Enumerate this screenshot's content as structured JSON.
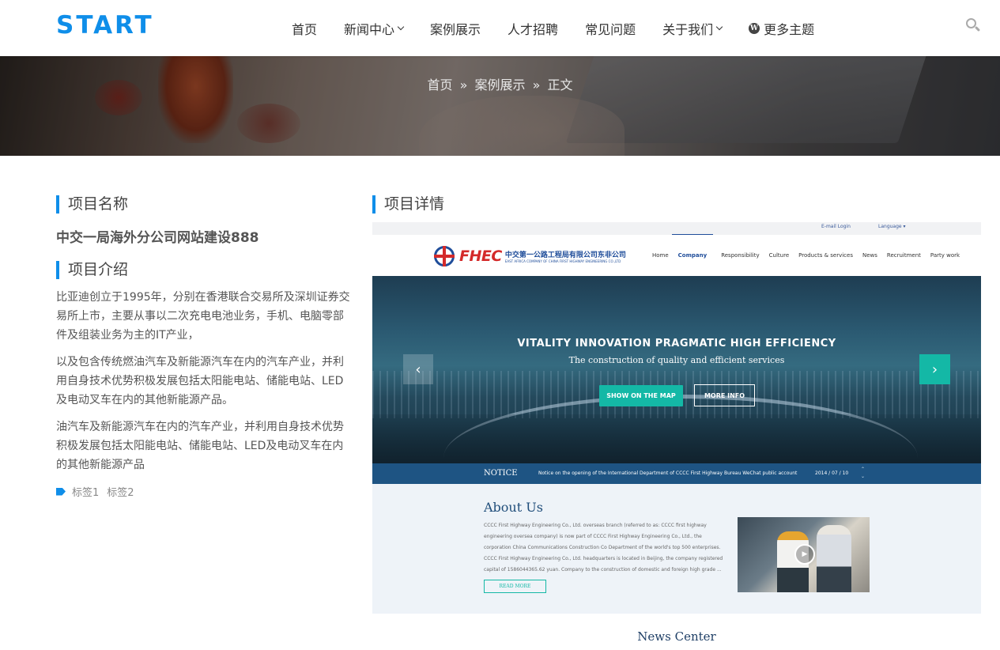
{
  "header": {
    "logo": "START",
    "nav": [
      {
        "label": "首页",
        "has_dropdown": false
      },
      {
        "label": "新闻中心",
        "has_dropdown": true
      },
      {
        "label": "案例展示",
        "has_dropdown": false
      },
      {
        "label": "人才招聘",
        "has_dropdown": false
      },
      {
        "label": "常见问题",
        "has_dropdown": false
      },
      {
        "label": "关于我们",
        "has_dropdown": true
      },
      {
        "label": "更多主题",
        "has_dropdown": false,
        "icon": "wordpress-icon"
      }
    ],
    "search_icon": "search-icon"
  },
  "banner": {
    "breadcrumb": [
      "首页",
      "案例展示",
      "正文"
    ],
    "separator": "»"
  },
  "left": {
    "name_title": "项目名称",
    "project_name": "中交一局海外分公司网站建设888",
    "intro_title": "项目介绍",
    "paragraphs": [
      "比亚迪创立于1995年，分别在香港联合交易所及深圳证券交易所上市，主要从事以二次充电电池业务，手机、电脑零部件及组装业务为主的IT产业，",
      "以及包含传统燃油汽车及新能源汽车在内的汽车产业，并利用自身技术优势积极发展包括太阳能电站、储能电站、LED及电动叉车在内的其他新能源产品。",
      "油汽车及新能源汽车在内的汽车产业，并利用自身技术优势积极发展包括太阳能电站、储能电站、LED及电动叉车在内的其他新能源产品"
    ],
    "tags": [
      "标签1",
      "标签2"
    ]
  },
  "right": {
    "detail_title": "项目详情",
    "mock": {
      "top_links": {
        "login": "E-mail Login",
        "language": "Language ▾"
      },
      "logo_text": "FHEC",
      "logo_cn": "中交第一公路工程局有限公司东非公司",
      "logo_en": "EAST AFRICA COMPANY OF CHINA FIRST HIGHWAY ENGINEERING CO.,LTD",
      "menu": [
        "Home",
        "Company",
        "Responsibility",
        "Culture",
        "Products & services",
        "News",
        "Recruitment",
        "Party work"
      ],
      "active_menu": "Company",
      "hero_title": "VITALITY  INNOVATION  PRAGMATIC  HIGH EFFICIENCY",
      "hero_subtitle": "The construction of quality and efficient services",
      "btn_map": "SHOW ON THE MAP",
      "btn_more": "MORE INFO",
      "notice_title": "NOTICE",
      "notice_text": "Notice on the opening of the International Department of CCCC First Highway Bureau WeChat public account",
      "notice_date": "2014 / 07 / 10",
      "about_title": "About Us",
      "about_text": "CCCC First Highway Engineering Co., Ltd. overseas branch (referred to as: CCCC first highway engineering oversea company) is now part of CCCC First Highway Engineering Co., Ltd., the corporation China Communications Construction Co Department of the world's top 500 enterprises. CCCC First Highway Engineering Co., Ltd. headquarters is located in Beijing, the company registered capital of 1586044365.62 yuan.  Company to the construction of domestic and foreign high grade ...",
      "read_more": "READ MORE",
      "news_center": "News Center"
    }
  },
  "colors": {
    "accent": "#0f8ee9",
    "teal": "#14b8a6",
    "notice_bar": "#1e5483"
  }
}
